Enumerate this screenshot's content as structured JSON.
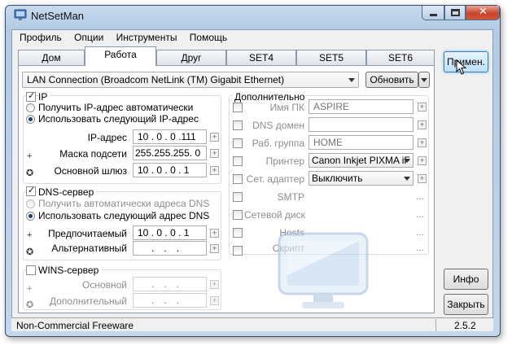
{
  "window": {
    "title": "NetSetMan"
  },
  "menu": [
    "Профиль",
    "Опции",
    "Инструменты",
    "Помощь"
  ],
  "tabs": [
    "Дом",
    "Работа",
    "Друг",
    "SET4",
    "SET5",
    "SET6"
  ],
  "adapter": {
    "value": "LAN Connection (Broadcom NetLink (TM) Gigabit Ethernet)",
    "refresh_label": "Обновить"
  },
  "ip": {
    "section": "IP",
    "auto": "Получить IP-адрес автоматически",
    "manual": "Использовать следующий IP-адрес",
    "ip_label": "IP-адрес",
    "ip": [
      "10",
      "0",
      "0",
      ".111"
    ],
    "mask_label": "Маска подсети",
    "mask": [
      "255",
      "255",
      "255",
      "0"
    ],
    "gw_label": "Основной шлюз",
    "gw": [
      "10",
      "0",
      "0",
      "1"
    ]
  },
  "dns": {
    "section": "DNS-сервер",
    "auto": "Получить автоматически адреса DNS",
    "manual": "Использовать следующий адрес DNS",
    "pref_label": "Предпочитаемый",
    "pref": [
      "10",
      "0",
      "0",
      "1"
    ],
    "alt_label": "Альтернативный",
    "alt": [
      "",
      ".",
      ".",
      "."
    ]
  },
  "wins": {
    "section": "WINS-сервер",
    "primary_label": "Основной",
    "secondary_label": "Дополнительный"
  },
  "extra": {
    "section": "Дополнительно",
    "pcname_label": "Имя ПК",
    "pcname": "ASPIRE",
    "dnsdomain_label": "DNS домен",
    "workgroup_label": "Раб. группа",
    "workgroup": "HOME",
    "printer_label": "Принтер",
    "printer": "Canon Inkjet PIXMA iF",
    "netadapter_label": "Сет. адаптер",
    "netadapter": "Выключить",
    "smtp_label": "SMTP",
    "netdisk_label": "Сетевой диск",
    "hosts_label": "Hosts",
    "script_label": "Скрипт",
    "dots": "..."
  },
  "buttons": {
    "apply": "Примен.",
    "info": "Инфо",
    "close": "Закрыть"
  },
  "status": {
    "left": "Non-Commercial Freeware",
    "version": "2.5.2"
  }
}
